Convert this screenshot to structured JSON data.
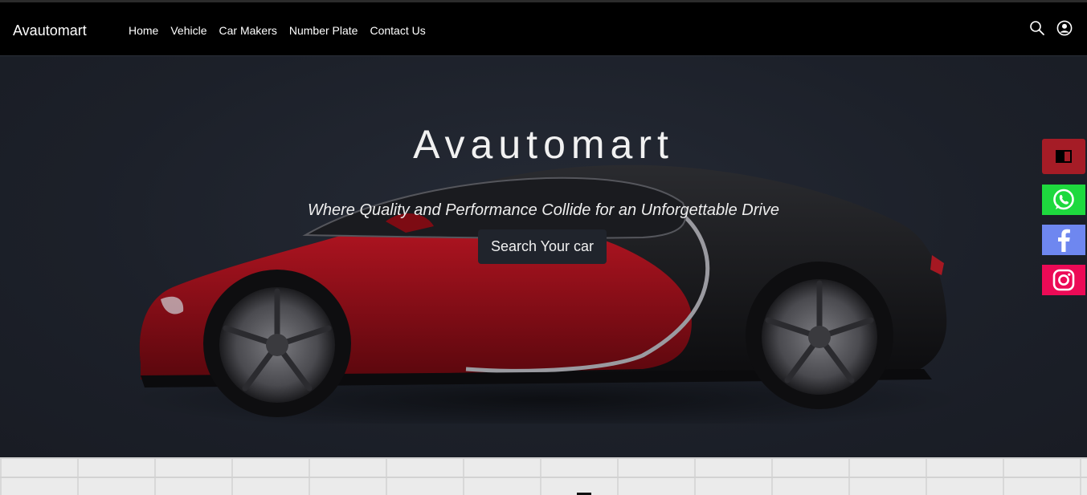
{
  "header": {
    "brand": "Avautomart",
    "nav": [
      "Home",
      "Vehicle",
      "Car Makers",
      "Number Plate",
      "Contact Us"
    ],
    "icons": [
      "search-icon",
      "user-account-icon"
    ]
  },
  "hero": {
    "title": "Avautomart",
    "subtitle": "Where Quality and Performance Collide for an Unforgettable Drive",
    "cta_label": "Search Your car"
  },
  "social": [
    {
      "icon": "book-icon",
      "color": "#a51c26"
    },
    {
      "icon": "whatsapp-icon",
      "color": "#1ed93e"
    },
    {
      "icon": "facebook-icon",
      "color": "#6e87f0"
    },
    {
      "icon": "instagram-icon",
      "color": "#ec0a56"
    }
  ],
  "colors": {
    "header_bg": "#000000",
    "hero_bg": "#1c2029",
    "button_bg": "#20242c",
    "car_red": "#8b0d16",
    "car_black": "#141416"
  }
}
